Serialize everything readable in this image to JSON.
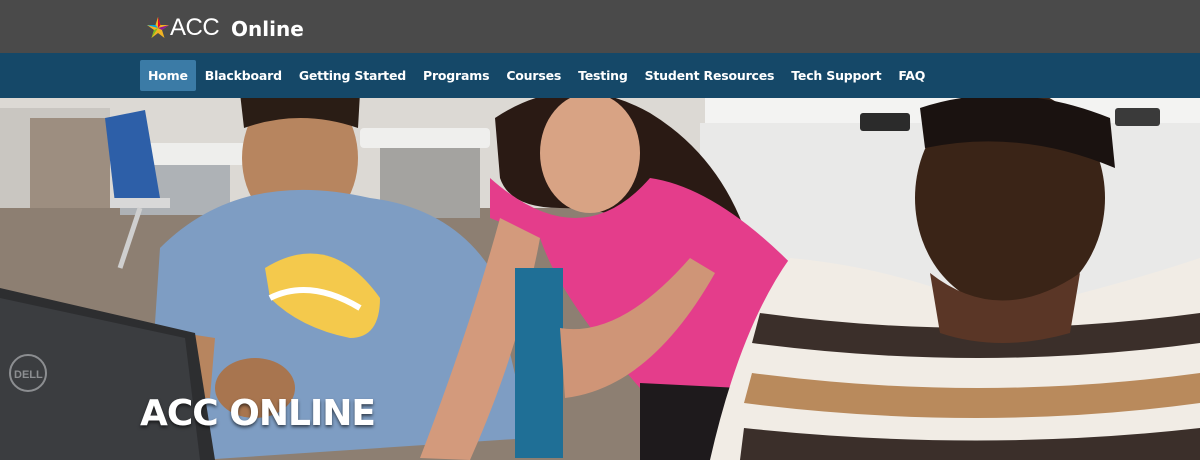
{
  "header": {
    "logo_text": "ACC",
    "site_name": "Online"
  },
  "nav": {
    "items": [
      {
        "label": "Home",
        "active": true
      },
      {
        "label": "Blackboard",
        "active": false
      },
      {
        "label": "Getting Started",
        "active": false
      },
      {
        "label": "Programs",
        "active": false
      },
      {
        "label": "Courses",
        "active": false
      },
      {
        "label": "Testing",
        "active": false
      },
      {
        "label": "Student Resources",
        "active": false
      },
      {
        "label": "Tech Support",
        "active": false
      },
      {
        "label": "FAQ",
        "active": false
      }
    ]
  },
  "hero": {
    "title": "ACC ONLINE",
    "monitor_brand": "DELL"
  },
  "colors": {
    "topbar": "#4a4a4a",
    "navbar": "#154868",
    "nav_active": "#3b7ba6"
  }
}
